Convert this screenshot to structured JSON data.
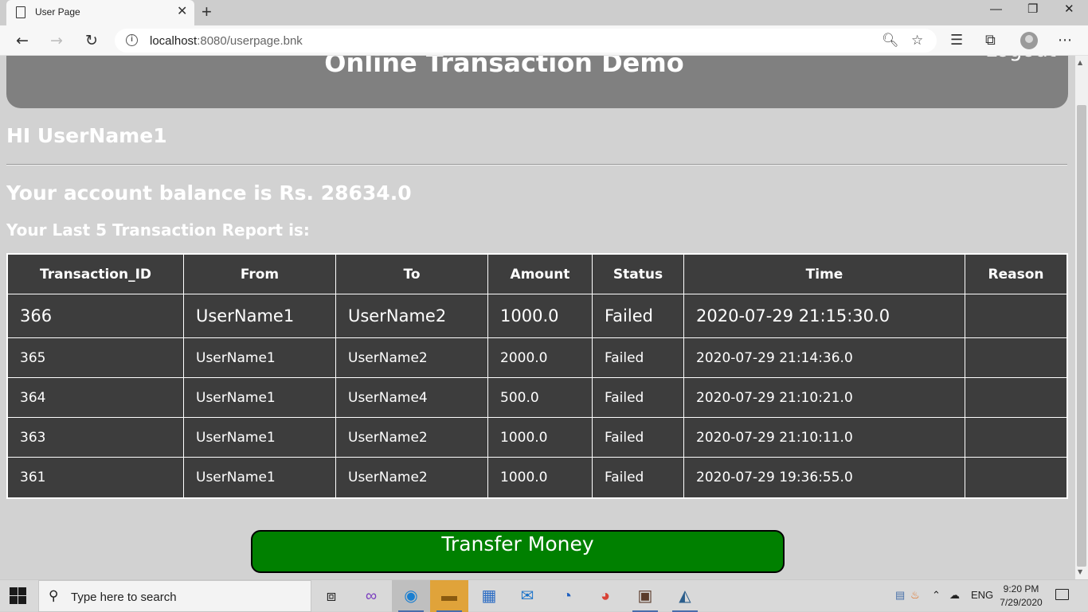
{
  "browser": {
    "tab_title": "User Page",
    "tab_close": "✕",
    "new_tab": "+",
    "url_host": "localhost",
    "url_path": ":8080/userpage.bnk",
    "window_controls": [
      "—",
      "❐",
      "✕"
    ],
    "icons": [
      "back-icon",
      "forward-icon",
      "refresh-icon",
      "info-icon",
      "zoom-icon",
      "favorite-star-icon",
      "favorites-icon",
      "collections-icon",
      "profile-icon",
      "more-icon"
    ]
  },
  "header": {
    "title": "Online Transaction Demo",
    "logout": "Logout"
  },
  "greeting": "HI UserName1",
  "balance": {
    "label": "Your account balance is Rs. ",
    "value": "28634.0"
  },
  "report_title": "Your Last 5 Transaction Report is:",
  "table": {
    "columns": [
      "Transaction_ID",
      "From",
      "To",
      "Amount",
      "Status",
      "Time",
      "Reason"
    ],
    "rows": [
      [
        "366",
        "UserName1",
        "UserName2",
        "1000.0",
        "Failed",
        "2020-07-29 21:15:30.0",
        ""
      ],
      [
        "365",
        "UserName1",
        "UserName2",
        "2000.0",
        "Failed",
        "2020-07-29 21:14:36.0",
        ""
      ],
      [
        "364",
        "UserName1",
        "UserName4",
        "500.0",
        "Failed",
        "2020-07-29 21:10:21.0",
        ""
      ],
      [
        "363",
        "UserName1",
        "UserName2",
        "1000.0",
        "Failed",
        "2020-07-29 21:10:11.0",
        ""
      ],
      [
        "361",
        "UserName1",
        "UserName2",
        "1000.0",
        "Failed",
        "2020-07-29 19:36:55.0",
        ""
      ]
    ]
  },
  "transfer_button": "Transfer Money",
  "taskbar": {
    "search_placeholder": "Type here to search",
    "lang": "ENG",
    "time": "9:20 PM",
    "date": "7/29/2020"
  },
  "colors": {
    "header_bg": "#808080",
    "page_bg": "#d2d2d2",
    "table_bg": "#3d3d3d",
    "button_bg": "#008000"
  }
}
